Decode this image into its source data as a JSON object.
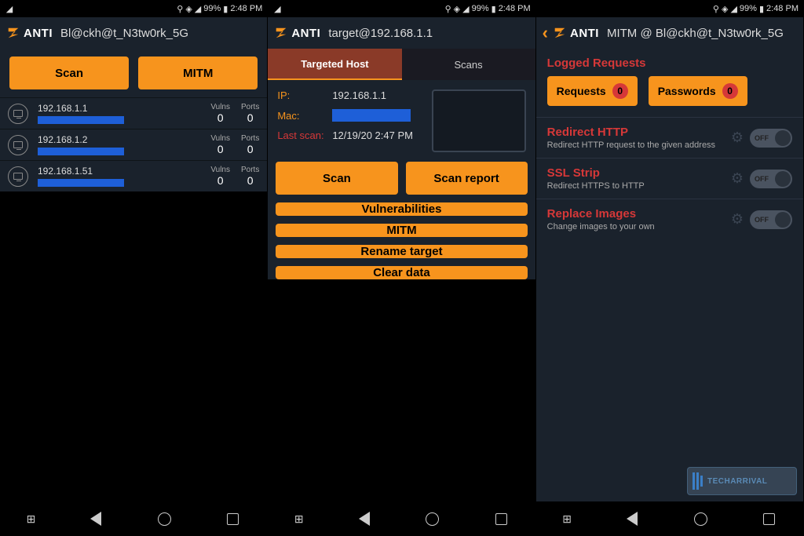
{
  "status": {
    "battery": "99%",
    "time": "2:48 PM"
  },
  "app_name": "ANTI",
  "panel1": {
    "title": "Bl@ckh@t_N3tw0rk_5G",
    "scan_btn": "Scan",
    "mitm_btn": "MITM",
    "vulns_label": "Vulns",
    "ports_label": "Ports",
    "devices": [
      {
        "ip": "192.168.1.1",
        "vulns": "0",
        "ports": "0"
      },
      {
        "ip": "192.168.1.2",
        "vulns": "0",
        "ports": "0"
      },
      {
        "ip": "192.168.1.51",
        "vulns": "0",
        "ports": "0"
      }
    ]
  },
  "panel2": {
    "title": "target@192.168.1.1",
    "tab_host": "Targeted Host",
    "tab_scans": "Scans",
    "ip_label": "IP:",
    "ip_val": "192.168.1.1",
    "mac_label": "Mac:",
    "lastscan_label": "Last scan:",
    "lastscan_val": "12/19/20 2:47 PM",
    "btns": {
      "scan": "Scan",
      "report": "Scan report",
      "vuln": "Vulnerabilities",
      "mitm": "MITM",
      "rename": "Rename target",
      "clear": "Clear data"
    }
  },
  "panel3": {
    "title": "MITM @ Bl@ckh@t_N3tw0rk_5G",
    "logged": "Logged Requests",
    "requests_btn": "Requests",
    "requests_count": "0",
    "passwords_btn": "Passwords",
    "passwords_count": "0",
    "toggles": [
      {
        "title": "Redirect HTTP",
        "sub": "Redirect HTTP request to the given address",
        "state": "OFF"
      },
      {
        "title": "SSL Strip",
        "sub": "Redirect HTTPS to HTTP",
        "state": "OFF"
      },
      {
        "title": "Replace Images",
        "sub": "Change images to your own",
        "state": "OFF"
      }
    ]
  },
  "watermark": "TECHARRIVAL"
}
